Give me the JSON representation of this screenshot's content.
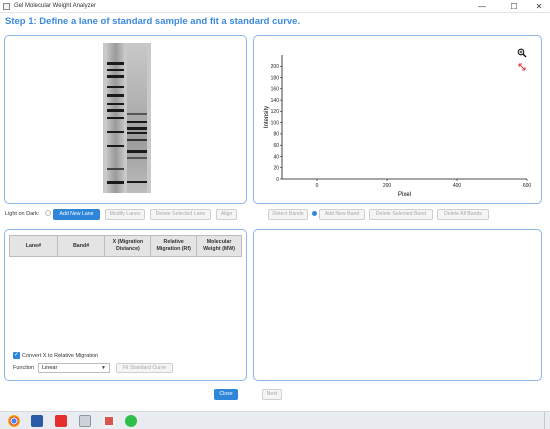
{
  "window": {
    "title": "Gel Molecular Weight Analyzer",
    "minimize": "—",
    "maximize": "☐",
    "close": "✕"
  },
  "step_title": "Step 1: Define a lane of standard sample and fit a standard curve.",
  "gel_toolbar": {
    "light_on_dark_label": "Light on Dark:",
    "add_lane": "Add New Lane",
    "modify_lanes": "Modify Lanes",
    "delete_lane": "Delete Selected Lane",
    "align": "Align"
  },
  "band_toolbar": {
    "detect_bands": "Detect Bands",
    "add_band": "Add New Band",
    "delete_band": "Delete Selected Band",
    "delete_all": "Delete All Bands"
  },
  "chart_data": {
    "type": "line",
    "xlabel": "Pixel",
    "ylabel": "Intensity",
    "xlim": [
      -100,
      600
    ],
    "ylim": [
      0,
      220
    ],
    "xticks": [
      0,
      200,
      400,
      600
    ],
    "yticks": [
      0,
      20,
      40,
      60,
      80,
      100,
      120,
      140,
      160,
      180,
      200
    ],
    "series": []
  },
  "plot_icons": {
    "zoom": "zoom-icon",
    "reset": "reset-axes-icon"
  },
  "table": {
    "headers": [
      "Lane#",
      "Band#",
      "X (Migration Distance)",
      "Relative Migration (Rf)",
      "Molecular Weight (MW)"
    ],
    "rows": []
  },
  "convert_label": "Convert X to Relative Migration",
  "function_label": "Function",
  "function_value": "Linear",
  "fit_button": "Fit Standard Curve",
  "close_button": "Close",
  "next_button": "Next",
  "colors": {
    "accent": "#2f86d8",
    "title": "#3c8ad8",
    "panel_border": "#8db6ea"
  }
}
